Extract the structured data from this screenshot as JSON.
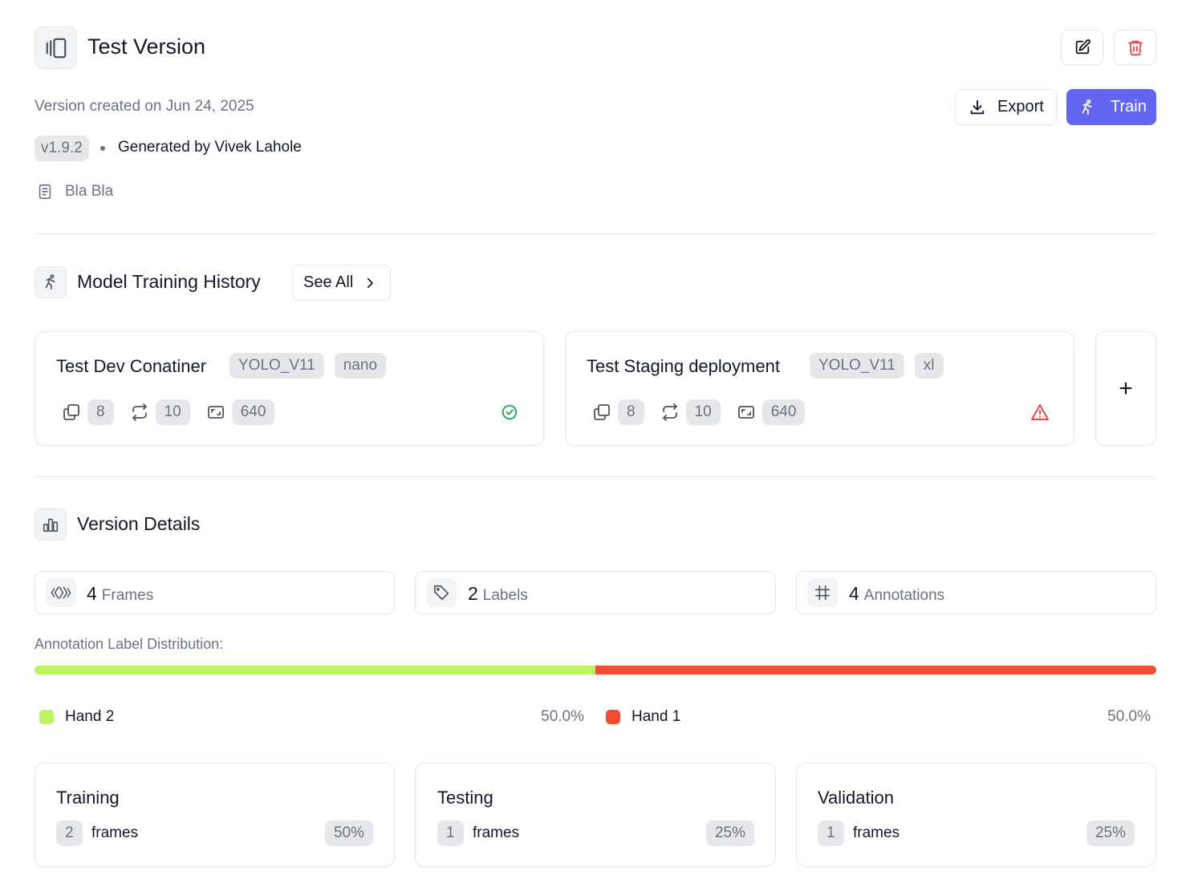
{
  "header": {
    "title": "Test Version",
    "created": "Version created on Jun 24, 2025",
    "version_badge": "v1.9.2",
    "generated_by": "Generated by Vivek Lahole",
    "description": "Bla Bla"
  },
  "actions": {
    "export_label": "Export",
    "train_label": "Train"
  },
  "training_history": {
    "title": "Model Training History",
    "see_all": "See All",
    "cards": [
      {
        "name": "Test Dev Conatiner",
        "model": "YOLO_V11",
        "size": "nano",
        "batch": "8",
        "epochs": "10",
        "imgsz": "640",
        "status": "success"
      },
      {
        "name": "Test Staging deployment",
        "model": "YOLO_V11",
        "size": "xl",
        "batch": "8",
        "epochs": "10",
        "imgsz": "640",
        "status": "warning"
      }
    ],
    "add_symbol": "+"
  },
  "version_details": {
    "title": "Version Details",
    "stats": [
      {
        "count": "4",
        "label": "Frames"
      },
      {
        "count": "2",
        "label": "Labels"
      },
      {
        "count": "4",
        "label": "Annotations"
      }
    ],
    "distribution_title": "Annotation Label Distribution:",
    "distribution": [
      {
        "label": "Hand 2",
        "percent": "50.0%",
        "fraction": 0.5,
        "color": "#bef264"
      },
      {
        "label": "Hand 1",
        "percent": "50.0%",
        "fraction": 0.5,
        "color": "#ef4d36"
      }
    ],
    "splits": [
      {
        "name": "Training",
        "count": "2",
        "unit": "frames",
        "percent": "50%"
      },
      {
        "name": "Testing",
        "count": "1",
        "unit": "frames",
        "percent": "25%"
      },
      {
        "name": "Validation",
        "count": "1",
        "unit": "frames",
        "percent": "25%"
      }
    ]
  },
  "colors": {
    "accent": "#6366f1",
    "danger": "#ef4444",
    "success": "#22a35a"
  }
}
